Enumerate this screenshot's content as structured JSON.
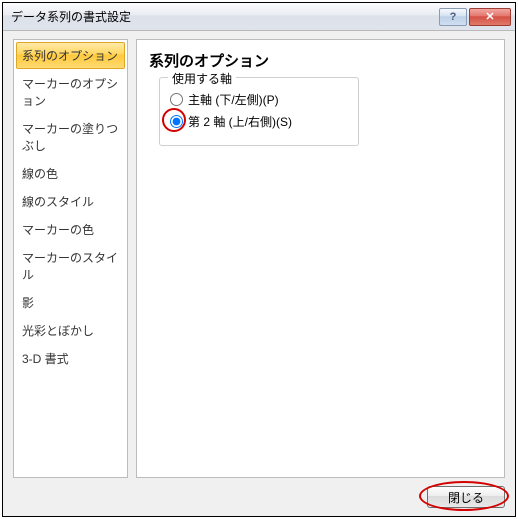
{
  "title": "データ系列の書式設定",
  "titlebar": {
    "help_glyph": "?",
    "close_glyph": "✕"
  },
  "sidebar": {
    "items": [
      "系列のオプション",
      "マーカーのオプション",
      "マーカーの塗りつぶし",
      "線の色",
      "線のスタイル",
      "マーカーの色",
      "マーカーのスタイル",
      "影",
      "光彩とぼかし",
      "3-D 書式"
    ],
    "selected_index": 0
  },
  "main": {
    "heading": "系列のオプション",
    "fieldset_legend": "使用する軸",
    "radios": [
      {
        "label": "主軸 (下/左側)(P)",
        "checked": false
      },
      {
        "label": "第 2 軸 (上/右側)(S)",
        "checked": true
      }
    ]
  },
  "footer": {
    "close_label": "閉じる"
  }
}
